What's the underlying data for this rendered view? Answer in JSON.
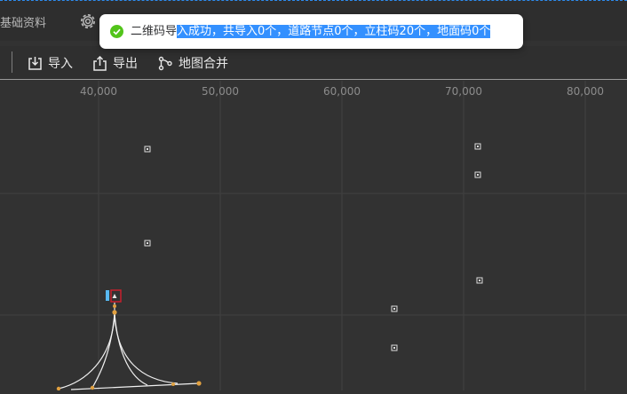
{
  "topbar": {
    "base_info": "基础资料"
  },
  "toolbar": {
    "import_label": "导入",
    "export_label": "导出",
    "merge_label": "地图合并"
  },
  "map": {
    "x_ticks": [
      "40,000",
      "50,000",
      "60,000",
      "70,000",
      "80,000"
    ],
    "colors": {
      "background": "#323232",
      "grid": "#414141",
      "road": "#f0f0f0",
      "node": "#e0a040",
      "selection": "#c8202c",
      "marker": "#58b8f0"
    }
  },
  "toast": {
    "status": "success",
    "icon": "check-circle-icon",
    "text_plain": "二维码导",
    "text_selected": "入成功，共导入0个，道路节点0个，立柱码20个，地面码0个"
  }
}
